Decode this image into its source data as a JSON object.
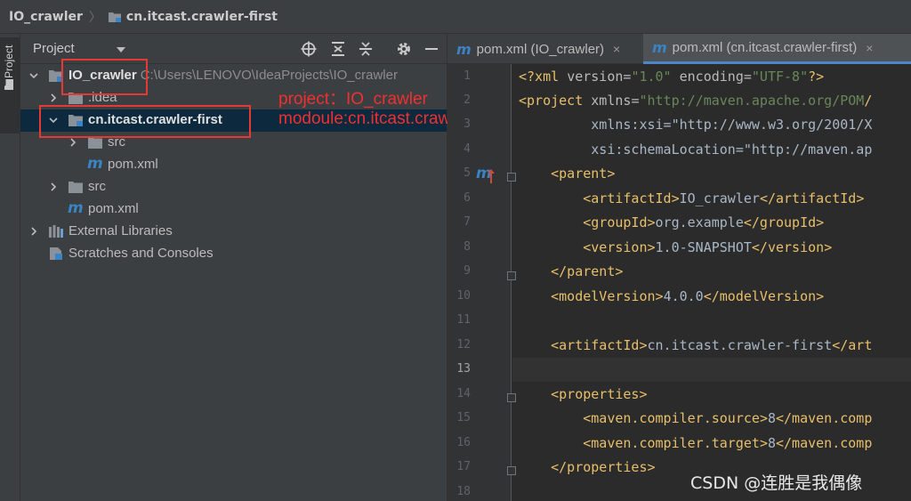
{
  "breadcrumb": {
    "project": "IO_crawler",
    "module": "cn.itcast.crawler-first"
  },
  "side_tab": {
    "label": "Project"
  },
  "project_panel": {
    "title": "Project",
    "tree": [
      {
        "label": "IO_crawler",
        "path": "C:\\Users\\LENOVO\\IdeaProjects\\IO_crawler",
        "icon": "module-folder-icon",
        "expanded": true
      },
      {
        "label": ".idea",
        "icon": "folder-icon",
        "expanded": false
      },
      {
        "label": "cn.itcast.crawler-first",
        "icon": "module-folder-icon",
        "expanded": true,
        "selected": true
      },
      {
        "label": "src",
        "icon": "folder-icon",
        "expanded": false
      },
      {
        "label": "pom.xml",
        "icon": "maven-icon"
      },
      {
        "label": "src",
        "icon": "folder-icon",
        "expanded": false
      },
      {
        "label": "pom.xml",
        "icon": "maven-icon"
      },
      {
        "label": "External Libraries",
        "icon": "library-icon",
        "expanded": false
      },
      {
        "label": "Scratches and Consoles",
        "icon": "scratch-icon"
      }
    ]
  },
  "annotations": {
    "project": "project：IO_crawler",
    "module": "modoule:cn.itcast.crawler-first",
    "color": "#f03030"
  },
  "editor": {
    "tabs": [
      {
        "label": "pom.xml (IO_crawler)",
        "active": false,
        "close": "×"
      },
      {
        "label": "pom.xml (cn.itcast.crawler-first)",
        "active": true,
        "close": "×"
      }
    ],
    "line_numbers": [
      "1",
      "2",
      "3",
      "4",
      "5",
      "6",
      "7",
      "8",
      "9",
      "10",
      "11",
      "12",
      "13",
      "14",
      "15",
      "16",
      "17",
      "18"
    ],
    "current_line": 13,
    "code": [
      "<?xml version=\"1.0\" encoding=\"UTF-8\"?>",
      "<project xmlns=\"http://maven.apache.org/POM/",
      "         xmlns:xsi=\"http://www.w3.org/2001/X",
      "         xsi:schemaLocation=\"http://maven.ap",
      "    <parent>",
      "        <artifactId>IO_crawler</artifactId>",
      "        <groupId>org.example</groupId>",
      "        <version>1.0-SNAPSHOT</version>",
      "    </parent>",
      "    <modelVersion>4.0.0</modelVersion>",
      "",
      "    <artifactId>cn.itcast.crawler-first</art",
      "",
      "    <properties>",
      "        <maven.compiler.source>8</maven.comp",
      "        <maven.compiler.target>8</maven.comp",
      "    </properties>",
      ""
    ]
  },
  "watermark": "CSDN @连胜是我偶像",
  "colors": {
    "tag": "#e8bf6a",
    "string": "#6a8759",
    "namespace": "#9876aa",
    "selection": "#0d293e",
    "accent": "#4a88c7"
  }
}
